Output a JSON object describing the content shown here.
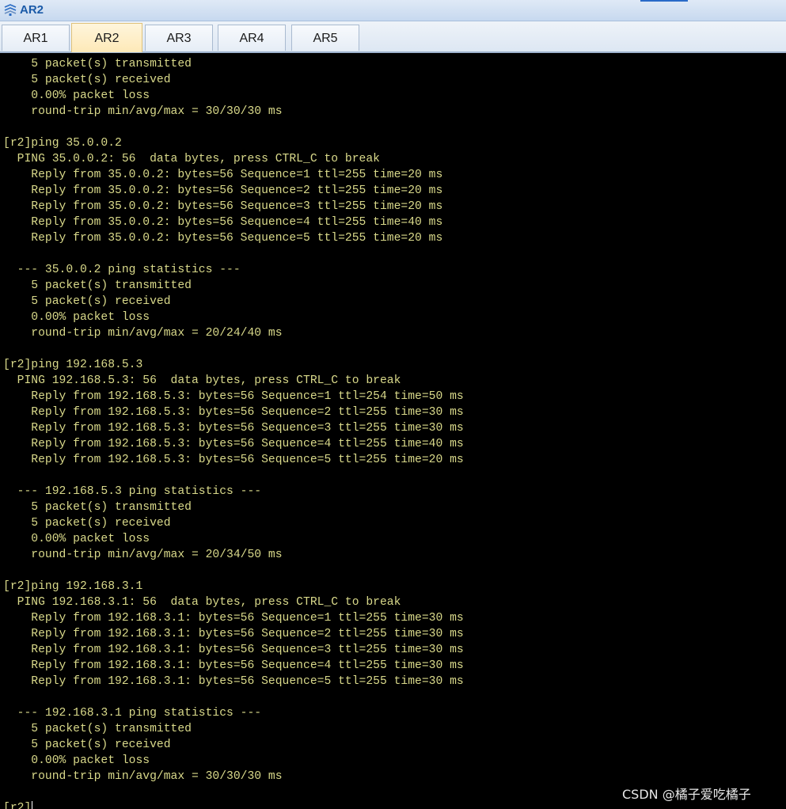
{
  "window": {
    "title": "AR2"
  },
  "tabs": [
    {
      "label": "AR1",
      "active": false
    },
    {
      "label": "AR2",
      "active": true
    },
    {
      "label": "AR3",
      "active": false
    },
    {
      "label": "AR4",
      "active": false
    },
    {
      "label": "AR5",
      "active": false
    }
  ],
  "terminal": {
    "lines": [
      "    5 packet(s) transmitted",
      "    5 packet(s) received",
      "    0.00% packet loss",
      "    round-trip min/avg/max = 30/30/30 ms",
      "",
      "[r2]ping 35.0.0.2",
      "  PING 35.0.0.2: 56  data bytes, press CTRL_C to break",
      "    Reply from 35.0.0.2: bytes=56 Sequence=1 ttl=255 time=20 ms",
      "    Reply from 35.0.0.2: bytes=56 Sequence=2 ttl=255 time=20 ms",
      "    Reply from 35.0.0.2: bytes=56 Sequence=3 ttl=255 time=20 ms",
      "    Reply from 35.0.0.2: bytes=56 Sequence=4 ttl=255 time=40 ms",
      "    Reply from 35.0.0.2: bytes=56 Sequence=5 ttl=255 time=20 ms",
      "",
      "  --- 35.0.0.2 ping statistics ---",
      "    5 packet(s) transmitted",
      "    5 packet(s) received",
      "    0.00% packet loss",
      "    round-trip min/avg/max = 20/24/40 ms",
      "",
      "[r2]ping 192.168.5.3",
      "  PING 192.168.5.3: 56  data bytes, press CTRL_C to break",
      "    Reply from 192.168.5.3: bytes=56 Sequence=1 ttl=254 time=50 ms",
      "    Reply from 192.168.5.3: bytes=56 Sequence=2 ttl=255 time=30 ms",
      "    Reply from 192.168.5.3: bytes=56 Sequence=3 ttl=255 time=30 ms",
      "    Reply from 192.168.5.3: bytes=56 Sequence=4 ttl=255 time=40 ms",
      "    Reply from 192.168.5.3: bytes=56 Sequence=5 ttl=255 time=20 ms",
      "",
      "  --- 192.168.5.3 ping statistics ---",
      "    5 packet(s) transmitted",
      "    5 packet(s) received",
      "    0.00% packet loss",
      "    round-trip min/avg/max = 20/34/50 ms",
      "",
      "[r2]ping 192.168.3.1",
      "  PING 192.168.3.1: 56  data bytes, press CTRL_C to break",
      "    Reply from 192.168.3.1: bytes=56 Sequence=1 ttl=255 time=30 ms",
      "    Reply from 192.168.3.1: bytes=56 Sequence=2 ttl=255 time=30 ms",
      "    Reply from 192.168.3.1: bytes=56 Sequence=3 ttl=255 time=30 ms",
      "    Reply from 192.168.3.1: bytes=56 Sequence=4 ttl=255 time=30 ms",
      "    Reply from 192.168.3.1: bytes=56 Sequence=5 ttl=255 time=30 ms",
      "",
      "  --- 192.168.3.1 ping statistics ---",
      "    5 packet(s) transmitted",
      "    5 packet(s) received",
      "    0.00% packet loss",
      "    round-trip min/avg/max = 30/30/30 ms",
      "",
      "[r2]"
    ],
    "text_color": "#d9d98a",
    "background": "#000000"
  },
  "watermark": "CSDN @橘子爱吃橘子",
  "icons": {
    "title_icon": "network-router-icon"
  },
  "colors": {
    "active_tab": "#fde9b8",
    "title_text": "#1a5aa8"
  }
}
